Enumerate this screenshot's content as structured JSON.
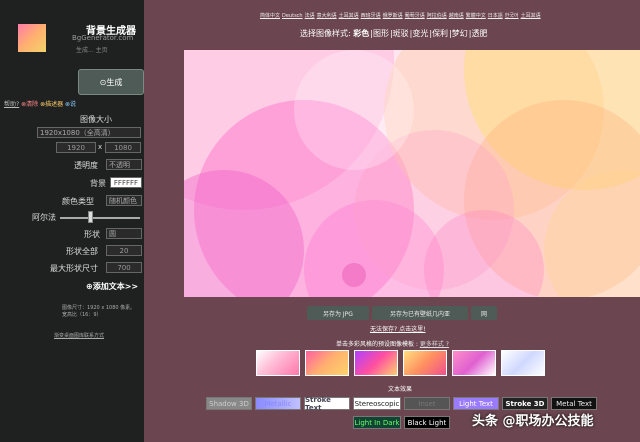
{
  "site": {
    "title": "背景生成器",
    "subtitle": "BgGenerator.com",
    "tagline": "生成... 主页"
  },
  "sidebar": {
    "generate_label": "⊙生成",
    "help_prefix": "帮助?",
    "help_opt1": "⊗清除",
    "help_opt2": "⊗描述器",
    "help_opt3": "⊗说",
    "size_label": "图像大小",
    "size_select": "1920x1080（全高清）",
    "width_value": "1920",
    "times": "x",
    "height_value": "1080",
    "opacity_label": "透明度",
    "opacity_select": "不透明",
    "bg_label": "背景",
    "bg_value": "FFFFFF",
    "color_type_label": "颜色类型",
    "color_type_select": "随机颜色",
    "alpha_label": "阿尔法",
    "shape_label": "形状",
    "shape_select": "圆",
    "shape_all_label": "形状全部",
    "shape_all_value": "20",
    "max_shape_label": "最大形状尺寸",
    "max_shape_value": "700",
    "add_text_label": "⊕添加文本>>",
    "info_line1": "图像尺寸：1920 x 1080 像素。",
    "info_line2": "宽高比（16：9）",
    "contact": "渐变桌面图库联系方式"
  },
  "langs": [
    "简体中文",
    "Deutsch",
    "法语",
    "意大利语",
    "土耳其语",
    "西班牙语",
    "俄罗斯语",
    "葡萄牙语",
    "阿拉伯语",
    "越南语",
    "繁體中文",
    "日本語",
    "한국어",
    "土耳其语"
  ],
  "styles": {
    "prefix": "选择图像样式:",
    "options": [
      "彩色",
      "图形",
      "斑驳",
      "变光",
      "保利",
      "梦幻",
      "透肥"
    ],
    "active_index": 0
  },
  "actions": {
    "save_jpg": "另存为 JPG",
    "save_wallpaper": "另存为已有壁纸几内亚",
    "third": "网"
  },
  "save_fail": "无法保存? 点击这里!",
  "templates": {
    "title": "单击多彩风格的预设图像模板 :",
    "more": "更多样式 ?"
  },
  "effects": {
    "title": "文本效果",
    "items": [
      "Shadow 3D",
      "Metallic",
      "Stroke Text",
      "Stereoscopic",
      "Inset",
      "Light Text",
      "Stroke 3D",
      "Metal Text",
      "Light In Dark",
      "Black Light"
    ]
  },
  "watermark": "头条 @职场办公技能",
  "colors": {
    "sidebar": "#1f2121",
    "page_bg": "#6b4650",
    "accent_button": "#4f5b56"
  }
}
